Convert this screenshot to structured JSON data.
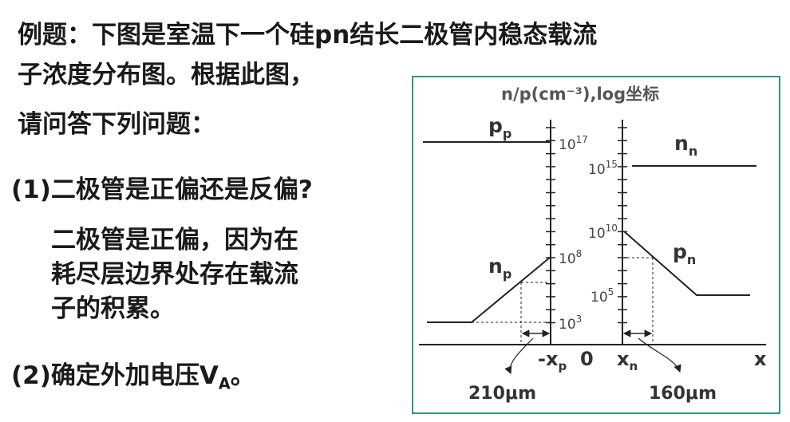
{
  "text": {
    "title_line1": "例题：下图是室温下一个硅pn结长二极管内稳态载流",
    "title_line2": "子浓度分布图。根据此图，",
    "title_line3": "请问答下列问题：",
    "q1": "(1)二极管是正偏还是反偏?",
    "a1_line1": "二极管是正偏，因为在",
    "a1_line2": "耗尽层边界处存在载流",
    "a1_line3": "子的积累。",
    "q2_prefix": "(2)确定外加电压V",
    "q2_sub": "A",
    "q2_suffix": "。"
  },
  "figure": {
    "y_axis_title": "n/p(cm⁻³),log坐标",
    "left_ticks": [
      {
        "base": "10",
        "exp": "17"
      },
      {
        "base": "10",
        "exp": "8"
      },
      {
        "base": "10",
        "exp": "3"
      }
    ],
    "right_ticks": [
      {
        "base": "10",
        "exp": "15"
      },
      {
        "base": "10",
        "exp": "10"
      },
      {
        "base": "10",
        "exp": "5"
      }
    ],
    "curve_labels": {
      "pp": {
        "main": "p",
        "sub": "p"
      },
      "np": {
        "main": "n",
        "sub": "p"
      },
      "nn": {
        "main": "n",
        "sub": "n"
      },
      "pn": {
        "main": "p",
        "sub": "n"
      }
    },
    "x_labels": {
      "neg_xp": {
        "main": "-x",
        "sub": "p"
      },
      "zero": "0",
      "xn": {
        "main": "x",
        "sub": "n"
      },
      "x": "x"
    },
    "dims": {
      "left": "210μm",
      "right": "160μm"
    },
    "colors": {
      "border": "#2e9b7e",
      "line": "#222222"
    }
  }
}
